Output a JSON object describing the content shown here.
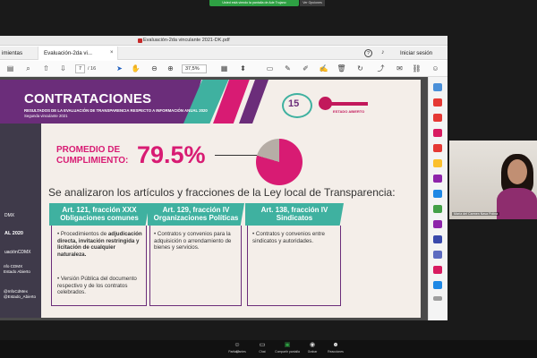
{
  "meeting": {
    "notice": "Usted está viendo la pantalla de Ade Trujano",
    "stop_label": "Ver Opciones",
    "controls": [
      {
        "label": "Participantes",
        "count": "47",
        "icon": "participants-icon"
      },
      {
        "label": "Chat",
        "icon": "chat-icon"
      },
      {
        "label": "Compartir pantalla",
        "icon": "share-screen-icon"
      },
      {
        "label": "Grabar",
        "icon": "record-icon"
      },
      {
        "label": "Reacciones",
        "icon": "reactions-icon"
      }
    ],
    "participant_name": "María del Carmen Nava Polina"
  },
  "acrobat": {
    "window_title": "Evaluación-2da vinculante 2021-DK.pdf",
    "tab_tools": "imientas",
    "tab_doc": "Evaluación-2da vi...",
    "tab_close": "×",
    "signin": "Iniciar sesión",
    "page_current": "7",
    "page_total": "/ 16",
    "zoom": "37,5%"
  },
  "slide": {
    "title": "CONTRATACIONES",
    "subtitle1": "RESULTADOS DE LA EVALUACIÓN DE TRANSPARENCIA RESPECTO A INFORMACIÓN ANUAL 2020",
    "subtitle2": "Segunda vinculante 2021",
    "logo_text": "15",
    "estado_abierto": "ESTADO ABIERTO",
    "promedio_label_1": "PROMEDIO DE",
    "promedio_label_2": "CUMPLIMIENTO:",
    "promedio_value": "79.5%",
    "analysis_text": "Se analizaron los artículos y fracciones de la Ley local de Transparencia:",
    "columns": [
      {
        "head1": "Art. 121, fracción XXX",
        "head2": "Obligaciones comunes",
        "b1_pre": "Procedimientos de ",
        "b1_bold": "adjudicación directa, invitación restringida y licitación de cualquier naturaleza.",
        "b2": "Versión Pública del documento respectivo y de los contratos celebrados."
      },
      {
        "head1": "Art. 129, fracción IV",
        "head2": "Organizaciones Políticas",
        "b1": "Contratos y convenios para la adquisición o arrendamiento de bienes y servicios."
      },
      {
        "head1": "Art. 138, fracción IV",
        "head2": "Sindicatos",
        "b1": "Contratos y convenios entre sindicatos y autoridades."
      }
    ],
    "side_0": "DMX",
    "side_1": "AL 2020",
    "side_2": "uaciónCDMX",
    "side_3a": "nfo CDMX",
    "side_3b": "Estado Abierto",
    "side_4a": "@InfoCdMex",
    "side_4b": "@Estado_Abierto"
  },
  "chart_data": {
    "type": "pie",
    "values": [
      79.5,
      20.5
    ],
    "colors": [
      "#d81b73",
      "#b6ada6"
    ]
  },
  "colors": {
    "purple": "#6b2d7a",
    "magenta": "#d81b73",
    "teal": "#3fb1a0",
    "zoom_green": "#2ea043"
  }
}
